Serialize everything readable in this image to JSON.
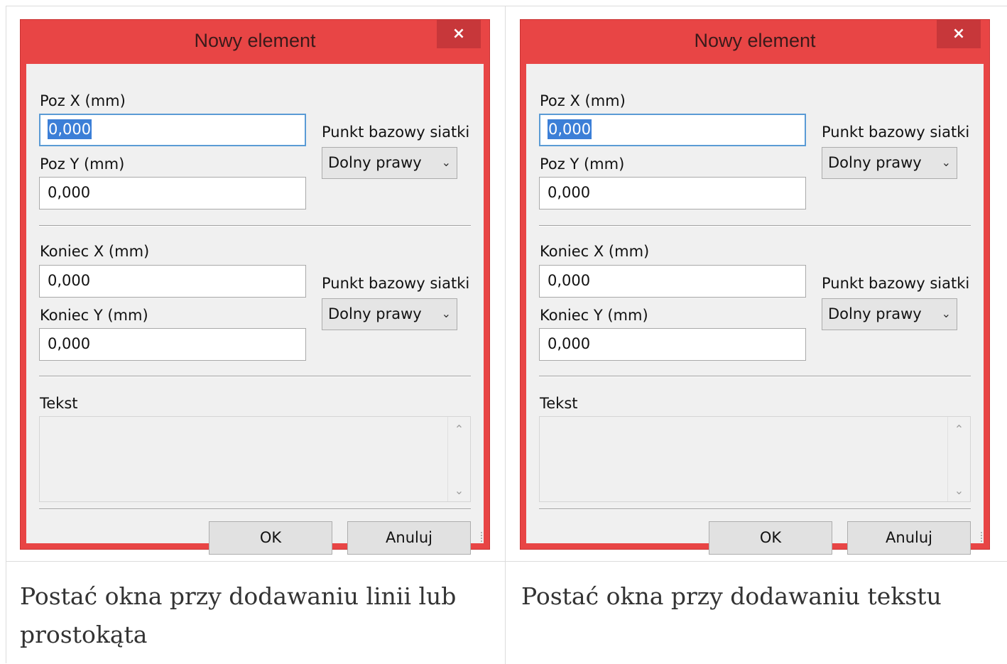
{
  "dialogs": [
    {
      "title": "Nowy element",
      "close_label": "×",
      "pos_x_label": "Poz X (mm)",
      "pos_x_value": "0,000",
      "pos_y_label": "Poz Y (mm)",
      "pos_y_value": "0,000",
      "grid_base_label_1": "Punkt bazowy siatki",
      "grid_base_value_1": "Dolny prawy",
      "end_x_label": "Koniec X (mm)",
      "end_x_value": "0,000",
      "end_y_label": "Koniec Y (mm)",
      "end_y_value": "0,000",
      "grid_base_label_2": "Punkt bazowy siatki",
      "grid_base_value_2": "Dolny prawy",
      "text_label": "Tekst",
      "text_value": "",
      "ok_label": "OK",
      "cancel_label": "Anuluj",
      "chevron_icon": "chevron-down-icon",
      "scroll_up_icon": "^",
      "scroll_down_icon": "v"
    },
    {
      "title": "Nowy element",
      "close_label": "×",
      "pos_x_label": "Poz X (mm)",
      "pos_x_value": "0,000",
      "pos_y_label": "Poz Y (mm)",
      "pos_y_value": "0,000",
      "grid_base_label_1": "Punkt bazowy siatki",
      "grid_base_value_1": "Dolny prawy",
      "end_x_label": "Koniec X (mm)",
      "end_x_value": "0,000",
      "end_y_label": "Koniec Y (mm)",
      "end_y_value": "0,000",
      "grid_base_label_2": "Punkt bazowy siatki",
      "grid_base_value_2": "Dolny prawy",
      "text_label": "Tekst",
      "text_value": "",
      "ok_label": "OK",
      "cancel_label": "Anuluj",
      "chevron_icon": "chevron-down-icon",
      "scroll_up_icon": "^",
      "scroll_down_icon": "v"
    }
  ],
  "captions": [
    "Postać okna przy dodawaniu linii lub prostokąta",
    "Postać okna przy dodawaniu tekstu"
  ],
  "colors": {
    "dialog_frame": "#e84545",
    "close_button": "#c7373a",
    "selection": "#3c7fd7",
    "focus_border": "#5a9bd5"
  }
}
